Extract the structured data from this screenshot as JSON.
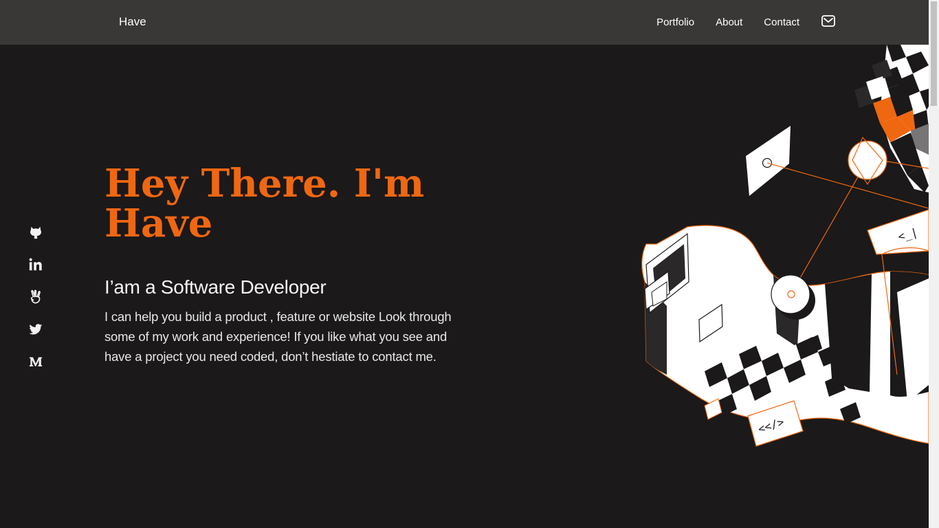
{
  "header": {
    "brand": "Have",
    "nav": [
      {
        "label": "Portfolio"
      },
      {
        "label": "About"
      },
      {
        "label": "Contact"
      }
    ],
    "mail_icon": "mail-icon"
  },
  "social": [
    {
      "icon": "github-icon"
    },
    {
      "icon": "linkedin-icon"
    },
    {
      "icon": "angellist-icon"
    },
    {
      "icon": "twitter-icon"
    },
    {
      "icon": "medium-icon"
    }
  ],
  "hero": {
    "title_line1": "Hey There. I'm",
    "title_line2": "Have",
    "subtitle": "I’am a Software Developer",
    "description": "I can help you build a product , feature or website Look through some of my work and experience! If you like what you see and have a project you need coded, don’t hestiate to contact me."
  },
  "illustration": {
    "code_tag_1": "<_|",
    "code_tag_2": "<</>"
  },
  "colors": {
    "accent": "#f06712",
    "background": "#1b1919",
    "header": "#3a3837",
    "text": "#ffffff"
  }
}
